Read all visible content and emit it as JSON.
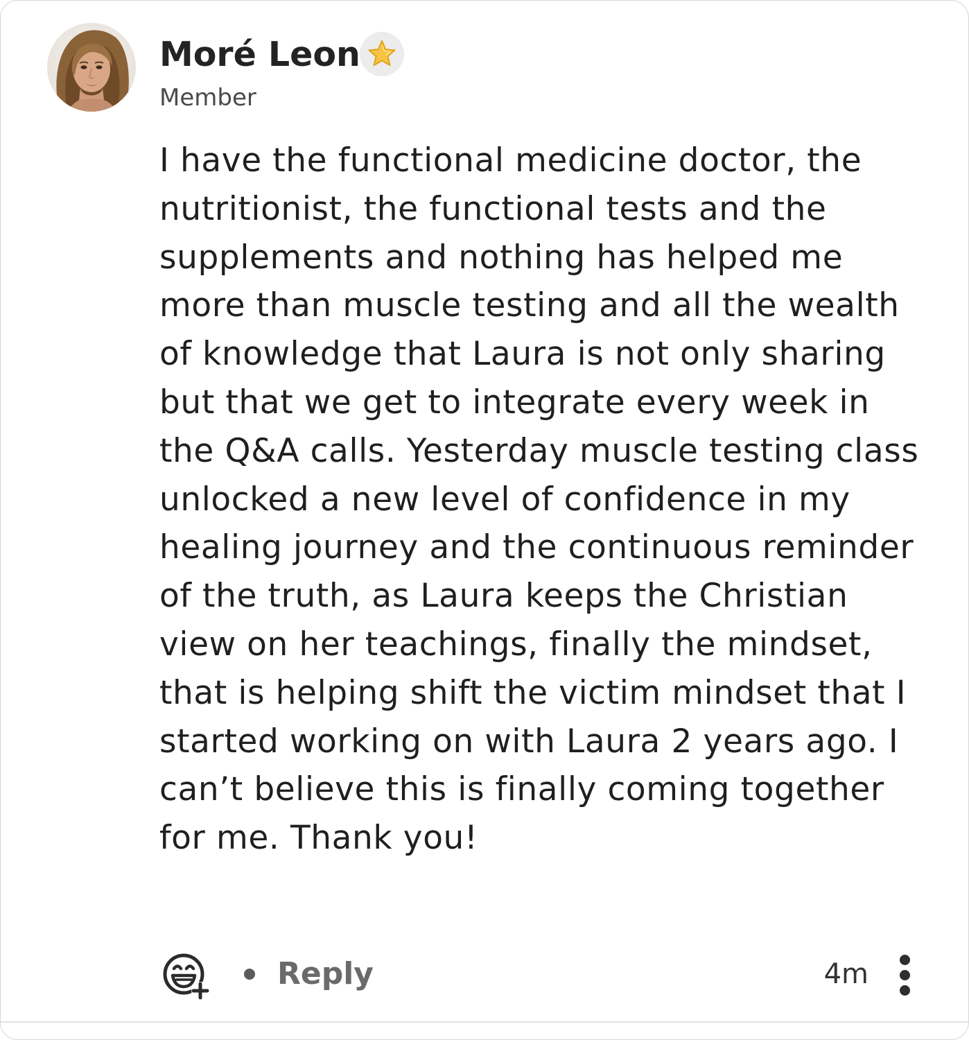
{
  "comment": {
    "author": {
      "name": "Moré Leon",
      "role": "Member",
      "avatar_icon": "profile-photo",
      "badge_icon": "star-icon"
    },
    "body": "I have the functional medicine doctor, the nutritionist, the functional tests and the supplements and nothing has helped me more than muscle testing and all the wealth of knowledge that Laura is not only sharing but that we get to integrate every week in the Q&A calls. Yesterday muscle testing class unlocked a new level of confidence in my healing journey and the continuous reminder of the truth, as Laura keeps the Christian view on her teachings, finally the mindset, that is helping shift the victim mindset that I started working on with Laura 2 years ago. I can’t believe this is finally coming together for me. Thank you!",
    "footer": {
      "reaction_icon": "add-reaction-icon",
      "reply_label": "Reply",
      "timestamp": "4m",
      "more_icon": "more-vertical-icon"
    }
  },
  "colors": {
    "text": "#1f1f1f",
    "muted": "#6a6a6a",
    "badge_bg": "#ececec",
    "star": "#f6c443"
  }
}
